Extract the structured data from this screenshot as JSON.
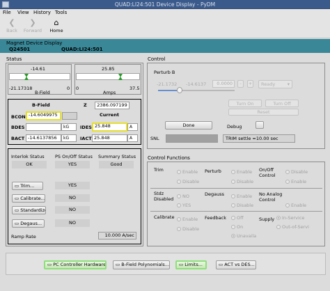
{
  "window": {
    "title": "QUAD:LI24:501 Device Display - PyDM"
  },
  "menu": [
    "File",
    "View",
    "History",
    "Tools"
  ],
  "toolbar": {
    "back": "Back",
    "forward": "Forward",
    "home": "Home"
  },
  "header": {
    "title": "Magnet Device Display",
    "device": "Q24501",
    "pv": "QUAD:LI24:501"
  },
  "status": {
    "title": "Status",
    "bfield_gauge": {
      "value": "-14.61",
      "min": "-21.17318",
      "max": "0",
      "label": "B-Field"
    },
    "amps_gauge": {
      "value": "25.85",
      "min": "0",
      "max": "37.5",
      "label": "Amps"
    },
    "bfield_label": "B-Field",
    "z_label": "Z",
    "z_value": "2386.097199",
    "current_label": "Current",
    "bcon_label": "BCON",
    "bcon_value": "-14.6049975",
    "bdes_label": "BDES",
    "bdes_value": "-14.6137",
    "bdes_unit": "kG",
    "ides_label": "IDES",
    "ides_value": "25.848",
    "ides_unit": "A",
    "bact_label": "BACT",
    "bact_value": "-14.6137856",
    "bact_unit": "kG",
    "iact_label": "IACT",
    "iact_value": "25.848",
    "iact_unit": "A",
    "interlock_label": "Interlok Status",
    "interlock_value": "OK",
    "ps_label": "PS On/Off Status",
    "ps_value": "YES",
    "summary_label": "Summary Status",
    "summary_value": "Good",
    "trim_btn": "Trim...",
    "trim_value": "YES",
    "calibrate_btn": "Calibrate...",
    "calibrate_value": "NO",
    "standardize_btn": "Standardize",
    "standardize_value": "NO",
    "degauss_btn": "Degaus...",
    "degauss_value": "NO",
    "ramp_label": "Ramp Rate",
    "ramp_value": "10.000 A/sec"
  },
  "control": {
    "title": "Control",
    "perturb_label": "Perturb B",
    "val1": "-21.1732",
    "val2": "-14.6137",
    "val3": "0.0000",
    "minus": "-",
    "plus": "+",
    "status_sel": "Ready",
    "turn_on": "Turn On",
    "turn_off": "Turn Off",
    "reset": "Reset",
    "done": "Done",
    "debug": "Debug",
    "snl_label": "SNL",
    "snl_value": "TRIM settle =10.00 sec"
  },
  "functions": {
    "title": "Control Functions",
    "trim_label": "Trim",
    "perturb_label": "Perturb",
    "onoff_label": "On/Off Control",
    "stdz_label": "Stdz Disabled",
    "degauss_label": "Degauss",
    "noanalog_label": "No Analog Control",
    "calibrate_label": "Calibrate",
    "feedback_label": "Feedback",
    "supply_label": "Supply",
    "enable": "Enable",
    "disable": "Disable",
    "yes": "YES",
    "no": "NO",
    "off": "Off",
    "on": "On",
    "unavail": "Unavaila",
    "inservice": "In-Service",
    "outservice": "Out-of-Servi"
  },
  "bottom": {
    "pc": "PC Controller Hardware...",
    "poly": "B-Field Polynomials...",
    "limits": "Limits...",
    "act": "ACT vs DES..."
  }
}
